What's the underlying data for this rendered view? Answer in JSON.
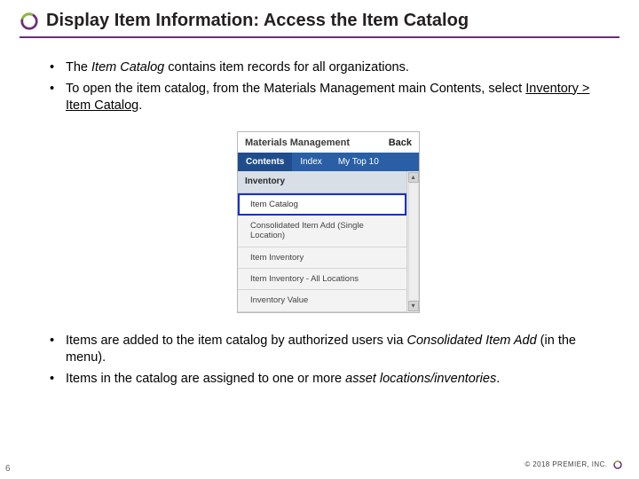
{
  "title": "Display Item Information: Access the Item Catalog",
  "bullets_top": [
    {
      "pre": "The ",
      "em": "Item Catalog ",
      "post": "contains item records for all organizations."
    },
    {
      "pre": "To open the item catalog, from the Materials Management main Contents, select ",
      "u": "Inventory > Item Catalog",
      "post": "."
    }
  ],
  "bullets_bottom": [
    {
      "pre": "Items are added to the item catalog by authorized users via ",
      "em": "Consolidated Item Add ",
      "post": "(in the menu)."
    },
    {
      "pre": "Items in the catalog are assigned to one or more ",
      "em": "asset locations/inventories",
      "post": "."
    }
  ],
  "panel": {
    "header_title": "Materials Management",
    "back": "Back",
    "tabs": {
      "contents": "Contents",
      "index": "Index",
      "mytop10": "My Top 10"
    },
    "section": "Inventory",
    "items": [
      "Item Catalog",
      "Consolidated Item Add (Single Location)",
      "Item Inventory",
      "Item Inventory - All Locations",
      "Inventory Value"
    ]
  },
  "footer": "© 2018 PREMIER, INC.",
  "page_num": "6"
}
